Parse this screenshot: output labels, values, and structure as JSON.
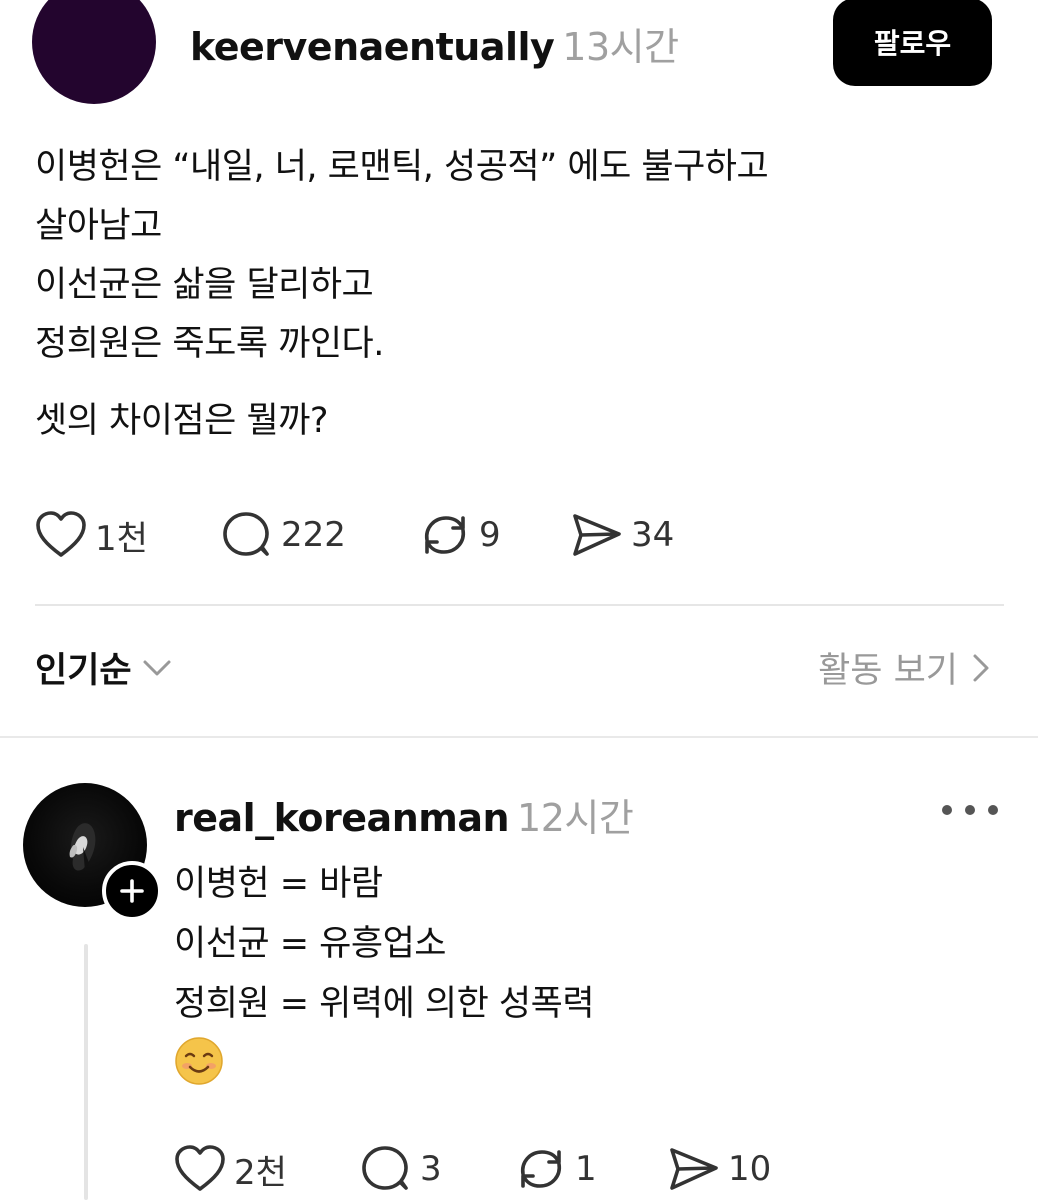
{
  "post": {
    "username": "keervenaentually",
    "time": "13시간",
    "follow_label": "팔로우",
    "lines": [
      "이병헌은 “내일, 너, 로맨틱, 성공적” 에도 불구하고",
      "살아남고",
      "이선균은 삶을 달리하고",
      "정희원은 죽도록 까인다."
    ],
    "question": "셋의 차이점은 뭘까?",
    "likes": "1천",
    "comments": "222",
    "reposts": "9",
    "shares": "34"
  },
  "sort": {
    "label": "인기순",
    "activity_label": "활동 보기"
  },
  "reply": {
    "username": "real_koreanman",
    "time": "12시간",
    "lines": [
      "이병헌 = 바람",
      "이선균 = 유흥업소",
      "정희원 = 위력에 의한 성폭력"
    ],
    "emoji": "☺️",
    "likes": "2천",
    "comments": "3",
    "reposts": "1",
    "shares": "10"
  },
  "icons": {
    "like": "heart-icon",
    "comment": "comment-bubble-icon",
    "repost": "repost-icon",
    "share": "send-icon",
    "sort": "chevron-down-icon",
    "activity": "chevron-right-icon",
    "more": "more-dots-icon",
    "add": "plus-icon"
  },
  "colors": {
    "post_avatar": "#23052e",
    "follow_button": "#000000",
    "muted_text": "#a0a0a0",
    "emoji": "#f5c44a"
  }
}
